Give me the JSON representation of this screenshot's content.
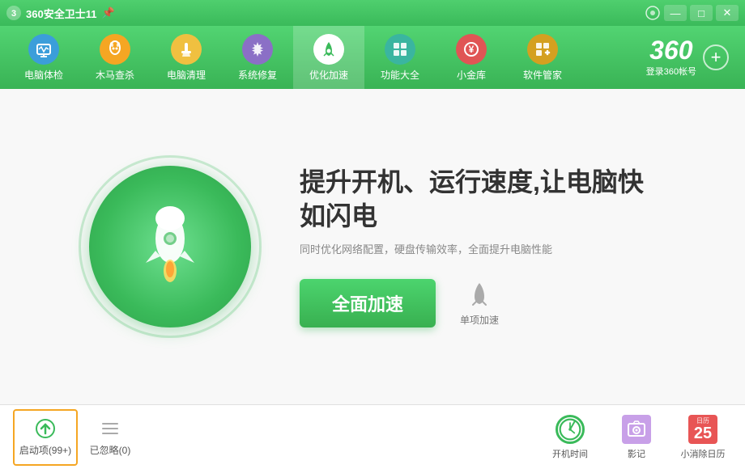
{
  "app": {
    "title": "360安全卫士11",
    "version": "11"
  },
  "titlebar": {
    "title": "360安全卫士11",
    "btn_pin": "📌",
    "btn_minimize": "—",
    "btn_maximize": "□",
    "btn_close": "✕"
  },
  "navbar": {
    "items": [
      {
        "id": "jiankang",
        "label": "电脑体检",
        "icon": "🖥",
        "color": "blue"
      },
      {
        "id": "muma",
        "label": "木马查杀",
        "icon": "🐴",
        "color": "orange"
      },
      {
        "id": "qingli",
        "label": "电脑清理",
        "icon": "🧹",
        "color": "yellow"
      },
      {
        "id": "xiufu",
        "label": "系统修复",
        "icon": "🔧",
        "color": "purple"
      },
      {
        "id": "jiasu",
        "label": "优化加速",
        "icon": "🚀",
        "color": "green-active",
        "active": true
      },
      {
        "id": "gongneng",
        "label": "功能大全",
        "icon": "⚡",
        "color": "teal"
      },
      {
        "id": "jinku",
        "label": "小金库",
        "icon": "💰",
        "color": "red"
      },
      {
        "id": "ruanjian",
        "label": "软件管家",
        "icon": "📦",
        "color": "gold"
      }
    ],
    "logo": "360",
    "login_label": "登录360帐号"
  },
  "main": {
    "title": "提升开机、运行速度,让电脑快如闪电",
    "subtitle": "同时优化网络配置，硬盘传输效率，全面提升电脑性能",
    "btn_full_boost": "全面加速",
    "single_boost_label": "单项加速"
  },
  "bottombar": {
    "items": [
      {
        "id": "startup",
        "label": "启动项(99+)",
        "selected": true
      },
      {
        "id": "ignored",
        "label": "已忽略(0)",
        "selected": false
      }
    ],
    "right_items": [
      {
        "id": "boot_time",
        "label": "开机时间"
      },
      {
        "id": "photo",
        "label": "影记"
      },
      {
        "id": "daily",
        "label": "小消除日历",
        "date": "25"
      }
    ]
  }
}
